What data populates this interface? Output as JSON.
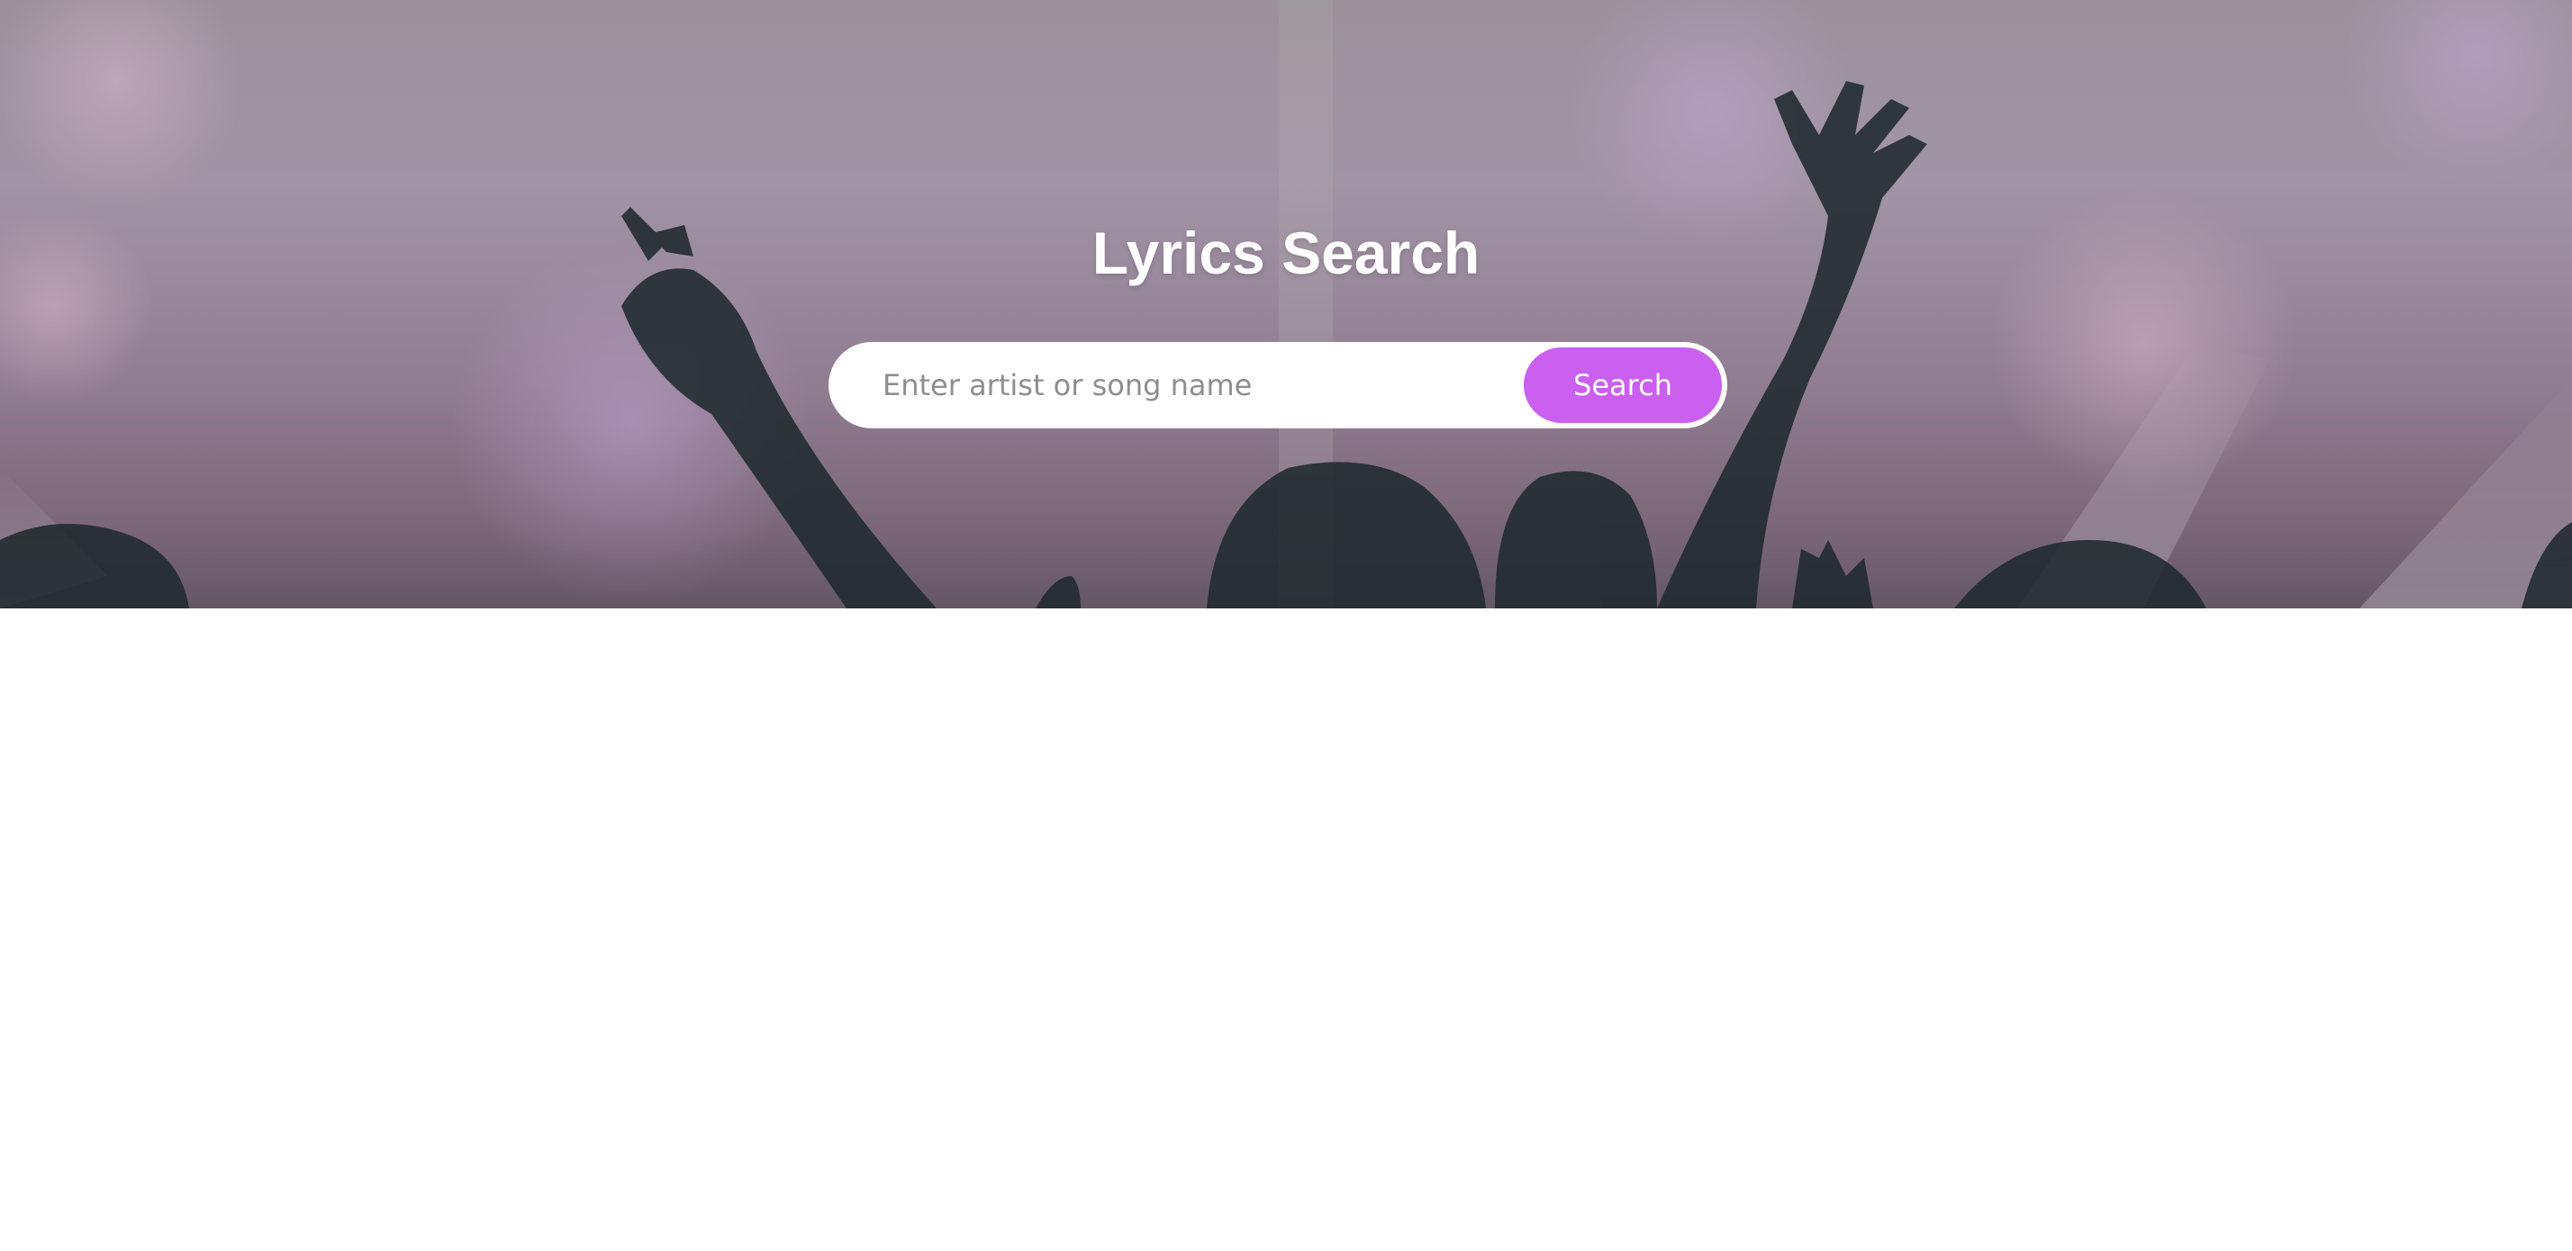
{
  "page": {
    "title": "Lyrics Search"
  },
  "search": {
    "placeholder": "Enter artist or song name",
    "value": "",
    "button_label": "Search"
  },
  "colors": {
    "accent": "#cb5ff0",
    "title_text": "#ffffff",
    "background": "#ffffff"
  }
}
